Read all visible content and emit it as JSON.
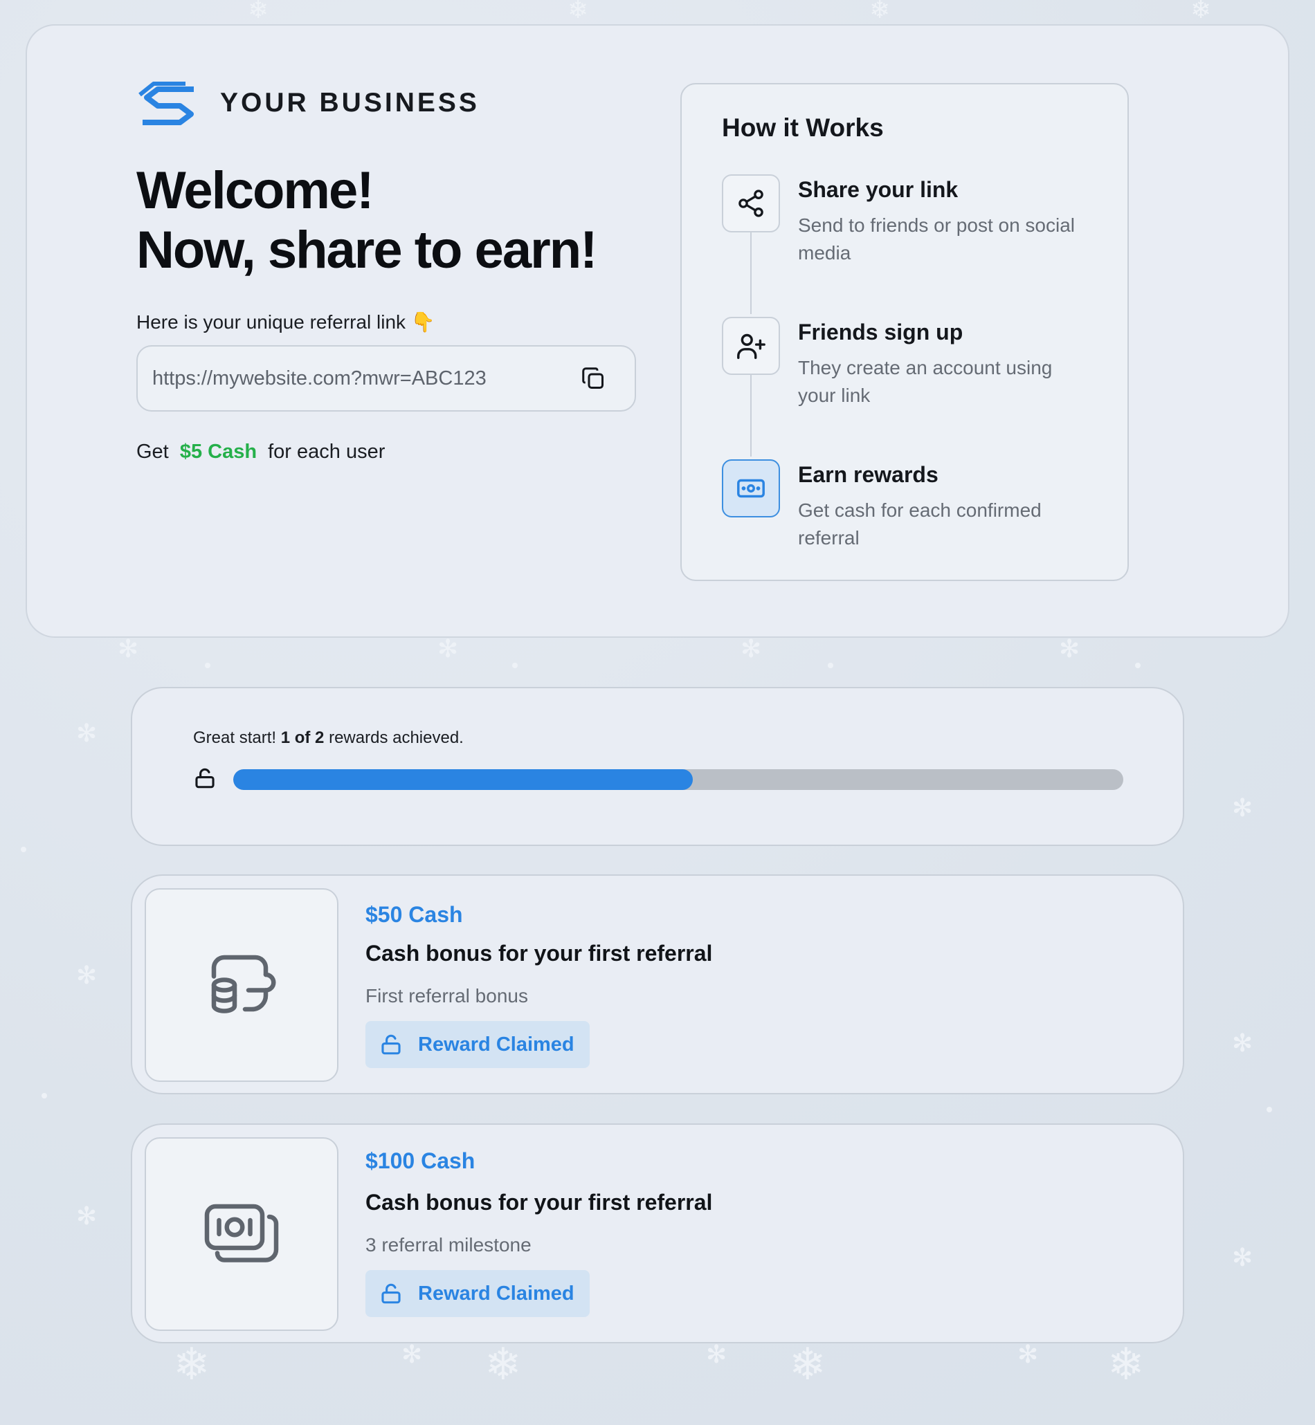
{
  "brand": {
    "name": "YOUR BUSINESS",
    "logo_icon": "brand-s-logo-icon"
  },
  "hero": {
    "headline_line1": "Welcome!",
    "headline_line2": "Now, share to earn!",
    "referral_label": "Here is your unique referral link 👇",
    "referral_link": "https://mywebsite.com?mwr=ABC123",
    "earn_prefix": "Get",
    "earn_amount": "$5 Cash",
    "earn_suffix": "for each user"
  },
  "how_it_works": {
    "title": "How it Works",
    "steps": [
      {
        "icon": "share-icon",
        "title": "Share your link",
        "description": "Send to friends or post on social media"
      },
      {
        "icon": "user-plus-icon",
        "title": "Friends sign up",
        "description": "They create an account using your link"
      },
      {
        "icon": "cash-icon",
        "title": "Earn rewards",
        "description": "Get cash for each confirmed referral"
      }
    ]
  },
  "progress": {
    "prefix": "Great start!",
    "count": "1 of 2",
    "suffix": "rewards achieved.",
    "fraction": 0.516
  },
  "rewards": [
    {
      "icon": "coins-wallet-icon",
      "amount": "$50 Cash",
      "title": "Cash bonus for your first referral",
      "subtitle": "First referral bonus",
      "button_label": "Reward Claimed"
    },
    {
      "icon": "banknotes-icon",
      "amount": "$100 Cash",
      "title": "Cash bonus for your first referral",
      "subtitle": "3 referral milestone",
      "button_label": "Reward Claimed"
    }
  ],
  "colors": {
    "accent": "#2a84e2",
    "cash_green": "#25b04a",
    "progress_track": "#babfc6"
  }
}
